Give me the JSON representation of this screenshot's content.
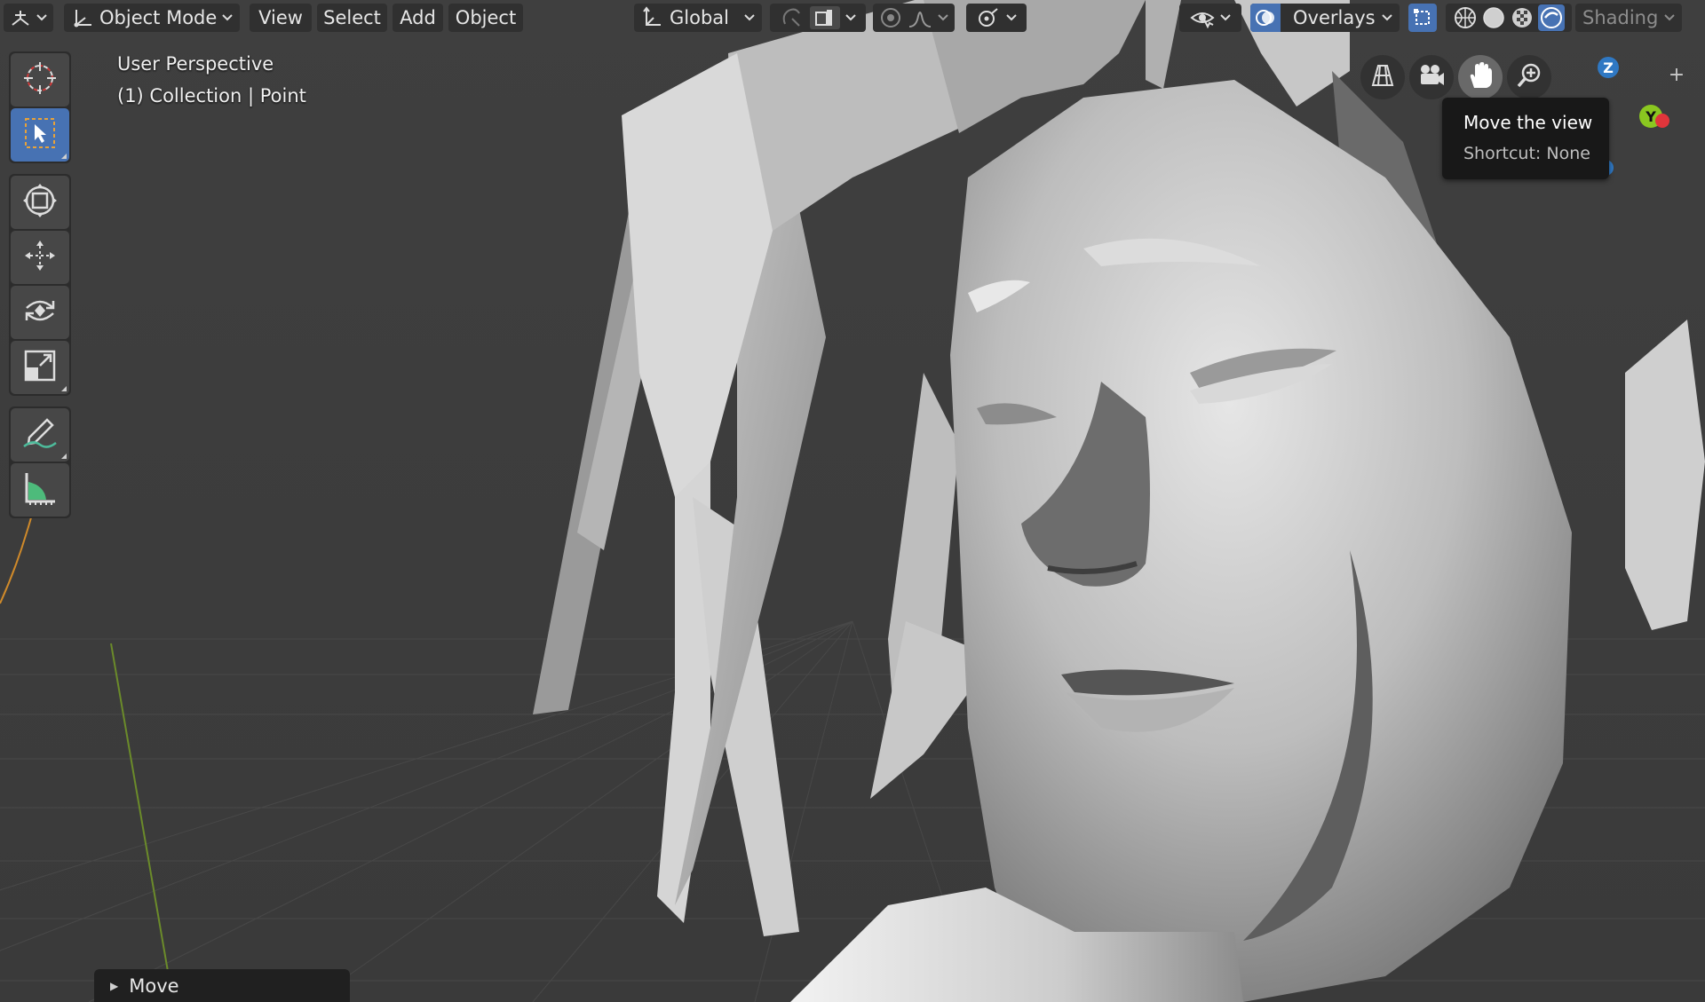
{
  "header": {
    "editor_type_icon": "3d-viewport-icon",
    "mode_label": "Object Mode",
    "menus": [
      "View",
      "Select",
      "Add",
      "Object"
    ],
    "orientation_label": "Global",
    "overlays_label": "Overlays",
    "shading_label": "Shading"
  },
  "viewport": {
    "view_name": "User Perspective",
    "collection_info": "(1) Collection | Point"
  },
  "toolbar": {
    "tools": [
      "cursor",
      "select-box",
      "transform",
      "move",
      "rotate",
      "scale",
      "annotate",
      "measure"
    ],
    "active_tool": "select-box"
  },
  "navigation": {
    "buttons": [
      "toggle-perspective",
      "camera-view",
      "move-view",
      "zoom-view"
    ],
    "hovered": "move-view",
    "axes": {
      "z": "Z",
      "y": "Y"
    }
  },
  "tooltip": {
    "title": "Move the view",
    "shortcut": "Shortcut: None"
  },
  "operator_panel": {
    "label": "Move"
  },
  "colors": {
    "accent": "#4772b3",
    "header_button": "#303030",
    "axis_x": "#e0353b",
    "axis_y": "#8ac720",
    "axis_z": "#2f78c3"
  }
}
